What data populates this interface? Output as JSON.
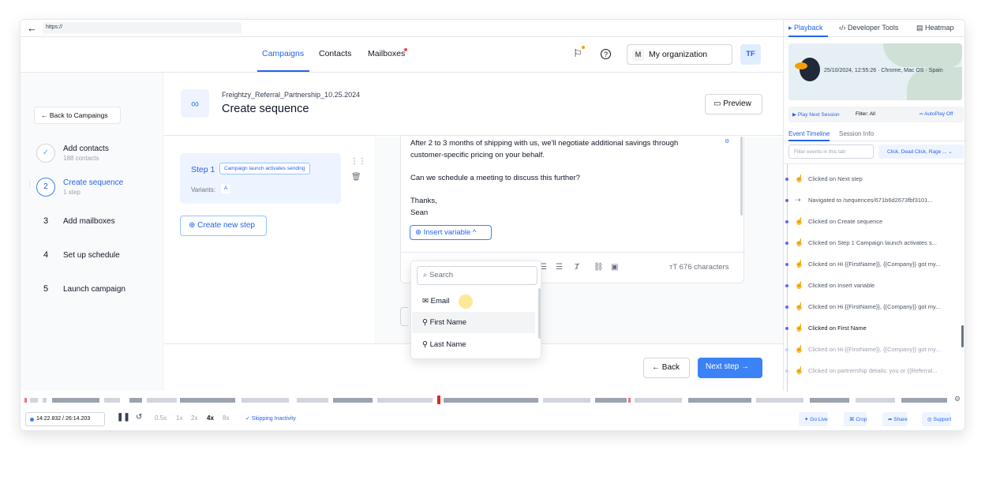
{
  "browser": {
    "back_icon": "arrow-left-icon",
    "url": "https://"
  },
  "nav": {
    "links": [
      "Campaigns",
      "Contacts",
      "Mailboxes"
    ],
    "org_badge": "M",
    "org_name": "My organization",
    "avatar": "TF"
  },
  "sidebar": {
    "back": "← Back to Campaings",
    "steps": [
      {
        "num": "✓",
        "title": "Add contacts",
        "sub": "188 contacts"
      },
      {
        "num": "2",
        "title": "Create sequence",
        "sub": "1 step"
      },
      {
        "num": "3",
        "title": "Add mailboxes"
      },
      {
        "num": "4",
        "title": "Set up schedule"
      },
      {
        "num": "5",
        "title": "Launch campaign"
      }
    ]
  },
  "header": {
    "icon": "∞",
    "subtitle": "Freightzy_Referral_Partnership_10.25.2024",
    "title": "Create sequence",
    "preview": "Preview"
  },
  "sequence": {
    "step_label": "Step 1",
    "step_tag": "Campaign launch activates sending",
    "variants_label": "Variants:",
    "variant": "A",
    "new_step": "Create new step"
  },
  "editor": {
    "lines": [
      "After 2 to 3 months of shipping with us, we'll negotiate additional savings through",
      "customer-specific pricing on your behalf.",
      "Can we schedule a meeting to discuss this further?",
      "Thanks,",
      "Sean"
    ],
    "insert_variable": "Insert variable",
    "char_count": "676 characters"
  },
  "dropdown": {
    "search_placeholder": "Search",
    "items": [
      "Email",
      "First Name",
      "Last Name"
    ]
  },
  "footer": {
    "back": "← Back",
    "next": "Next step →"
  },
  "rpanel": {
    "tabs": [
      "Playback",
      "Developer Tools",
      "Heatmap"
    ],
    "session_info": "25/10/2024, 12:55:26 · Chrome, Mac OS · Spain",
    "play_next": "Play Next Session",
    "filter": "Filter: All",
    "autoplay": "AutoPlay Off",
    "subtabs": [
      "Event Timeline",
      "Session Info"
    ],
    "filter_placeholder": "Filter events in this tab",
    "filter_select": "Click, Dead Click, Rage ...",
    "events": [
      "Clicked on Next step",
      "Navigated to /sequences/671b6d2673fbf3101...",
      "Clicked on Create sequence",
      "Clicked on Step 1 Campaign launch activates s...",
      "Clicked on Hi {{FirstName}}, {{Company}} got my...",
      "Clicked on Insert variable",
      "Clicked on Hi {{FirstName}}, {{Company}} got my...",
      "Clicked on First Name",
      "Clicked on Hi {{FirstName}}, {{Company}} got my...",
      "Clicked on partnership details: you or {{Referral..."
    ]
  },
  "player": {
    "time": "14:22.832 / 26:14.203",
    "speeds": [
      "0.5x",
      "1x",
      "2x",
      "4x",
      "8x"
    ],
    "active_speed": "4x",
    "skip": "✓ Skipping Inactivity",
    "buttons": [
      "Go Live",
      "Crop",
      "Share",
      "Support"
    ]
  }
}
